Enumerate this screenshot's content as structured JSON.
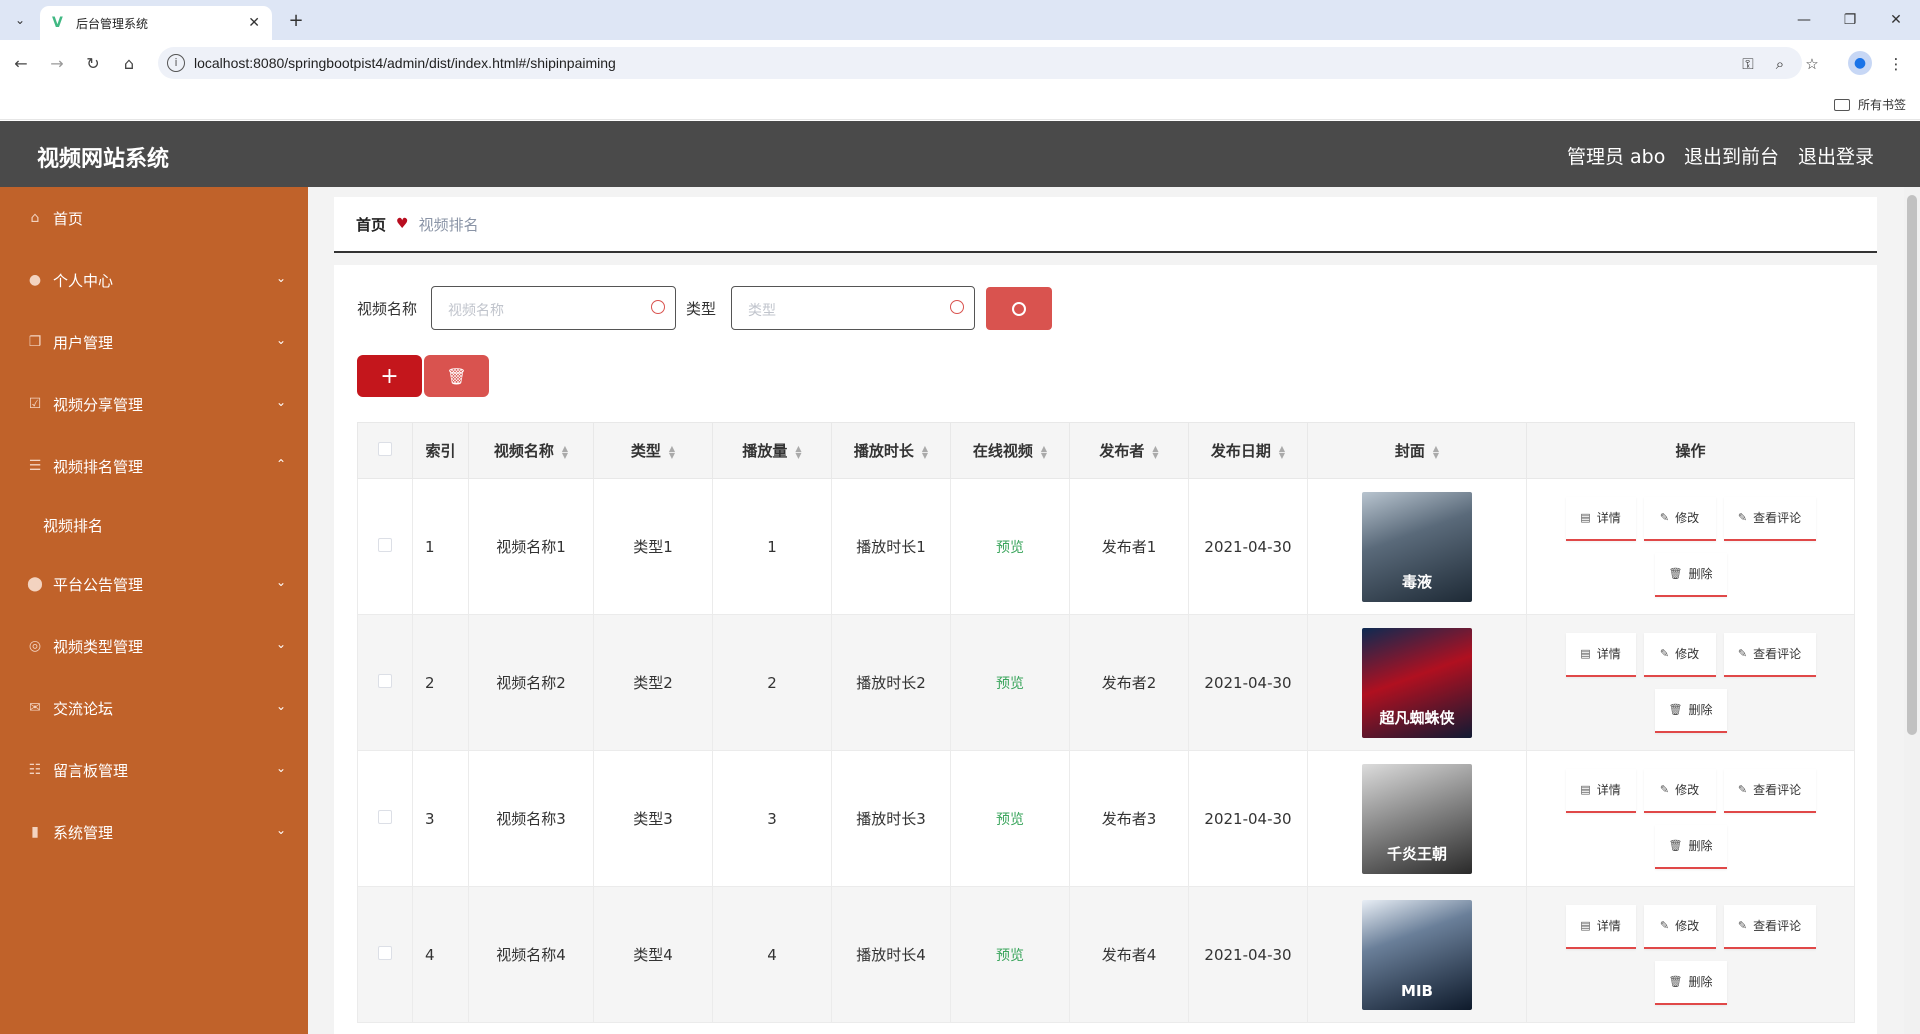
{
  "browser": {
    "tab_title": "后台管理系统",
    "url": "localhost:8080/springbootpist4/admin/dist/index.html#/shipinpaiming",
    "bookmarks_label": "所有书签"
  },
  "header": {
    "title": "视频网站系统",
    "user": "管理员 abo",
    "to_front": "退出到前台",
    "logout": "退出登录"
  },
  "sidebar": {
    "items": [
      {
        "label": "首页",
        "icon": "home-icon"
      },
      {
        "label": "个人中心",
        "icon": "user-icon"
      },
      {
        "label": "用户管理",
        "icon": "copy-icon"
      },
      {
        "label": "视频分享管理",
        "icon": "check-icon"
      },
      {
        "label": "视频排名管理",
        "icon": "list-icon"
      },
      {
        "label": "平台公告管理",
        "icon": "pin-icon"
      },
      {
        "label": "视频类型管理",
        "icon": "circle-icon"
      },
      {
        "label": "交流论坛",
        "icon": "mail-icon"
      },
      {
        "label": "留言板管理",
        "icon": "sliders-icon"
      },
      {
        "label": "系统管理",
        "icon": "chart-icon"
      }
    ],
    "sub_item": "视频排名"
  },
  "breadcrumb": {
    "home": "首页",
    "current": "视频排名"
  },
  "search": {
    "name_label": "视频名称",
    "name_placeholder": "视频名称",
    "type_label": "类型",
    "type_placeholder": "类型"
  },
  "table": {
    "columns": [
      "索引",
      "视频名称",
      "类型",
      "播放量",
      "播放时长",
      "在线视频",
      "发布者",
      "发布日期",
      "封面",
      "操作"
    ],
    "rows": [
      {
        "index": "1",
        "name": "视频名称1",
        "type": "类型1",
        "plays": "1",
        "duration": "播放时长1",
        "online": "预览",
        "publisher": "发布者1",
        "date": "2021-04-30",
        "cover_caption": "毒液"
      },
      {
        "index": "2",
        "name": "视频名称2",
        "type": "类型2",
        "plays": "2",
        "duration": "播放时长2",
        "online": "预览",
        "publisher": "发布者2",
        "date": "2021-04-30",
        "cover_caption": "超凡蜘蛛侠"
      },
      {
        "index": "3",
        "name": "视频名称3",
        "type": "类型3",
        "plays": "3",
        "duration": "播放时长3",
        "online": "预览",
        "publisher": "发布者3",
        "date": "2021-04-30",
        "cover_caption": "千炎王朝"
      },
      {
        "index": "4",
        "name": "视频名称4",
        "type": "类型4",
        "plays": "4",
        "duration": "播放时长4",
        "online": "预览",
        "publisher": "发布者4",
        "date": "2021-04-30",
        "cover_caption": "MIB"
      }
    ],
    "actions": {
      "detail": "详情",
      "edit": "修改",
      "comments": "查看评论",
      "delete": "删除"
    }
  },
  "colors": {
    "sidebar": "#c0622a",
    "header": "#4a4a4a",
    "accent": "#d9534f",
    "add": "#c4161c"
  }
}
